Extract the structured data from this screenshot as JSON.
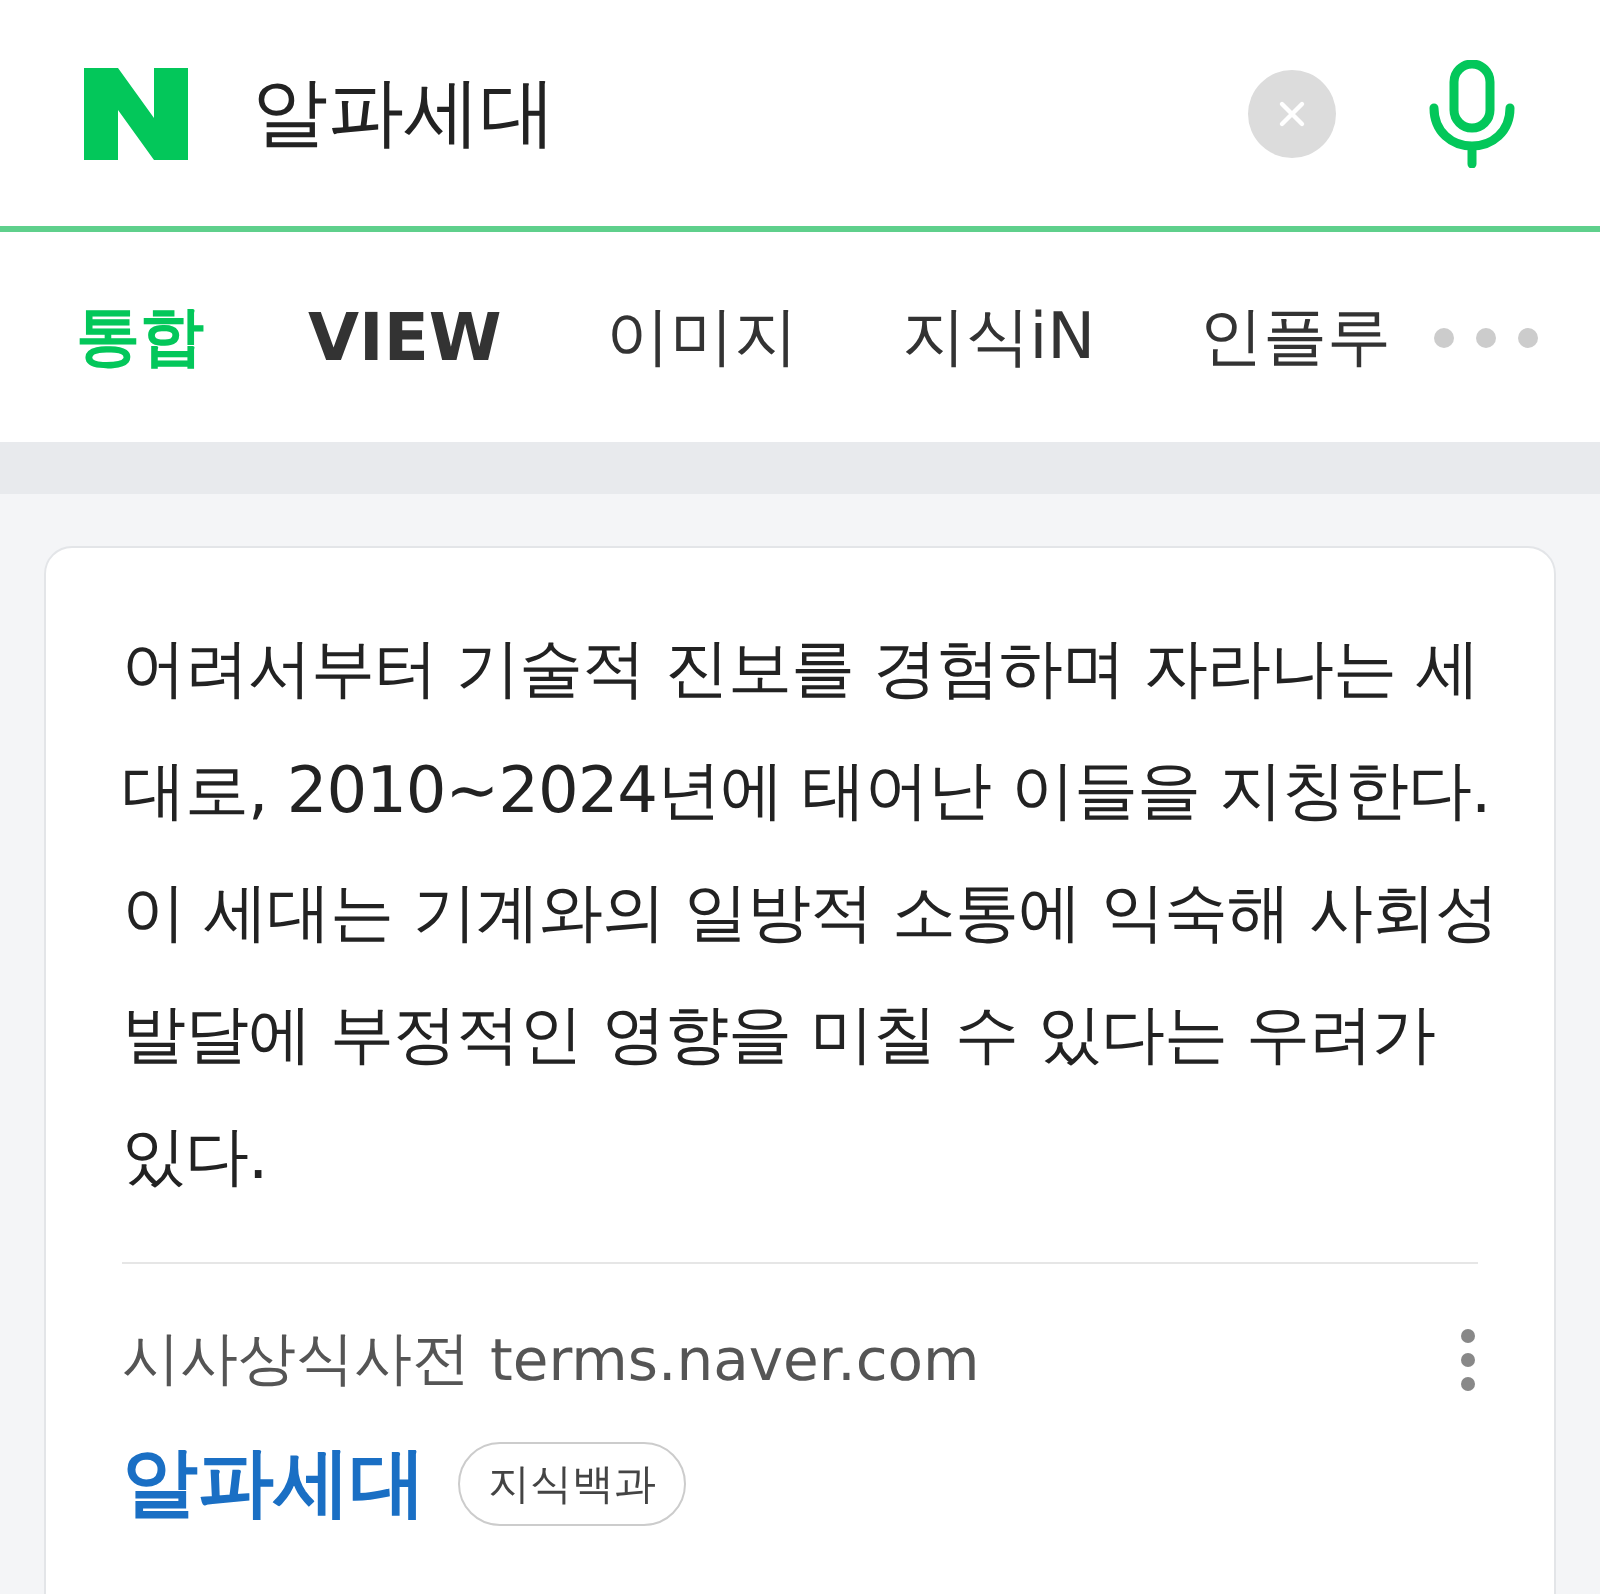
{
  "search": {
    "query": "알파세대"
  },
  "tabs": [
    {
      "label": "통합",
      "selected": true
    },
    {
      "label": "VIEW",
      "selected": false
    },
    {
      "label": "이미지",
      "selected": false
    },
    {
      "label": "지식iN",
      "selected": false
    },
    {
      "label": "인플루",
      "selected": false
    }
  ],
  "result": {
    "description": "어려서부터 기술적 진보를 경험하며 자라나는 세대로, 2010~2024년에 태어난 이들을 지칭한다. 이 세대는 기계와의 일방적 소통에 익숙해 사회성 발달에 부정적인 영향을 미칠 수 있다는 우려가 있다.",
    "source": "시사상식사전",
    "url": "terms.naver.com",
    "title": "알파세대",
    "tag": "지식백과"
  }
}
